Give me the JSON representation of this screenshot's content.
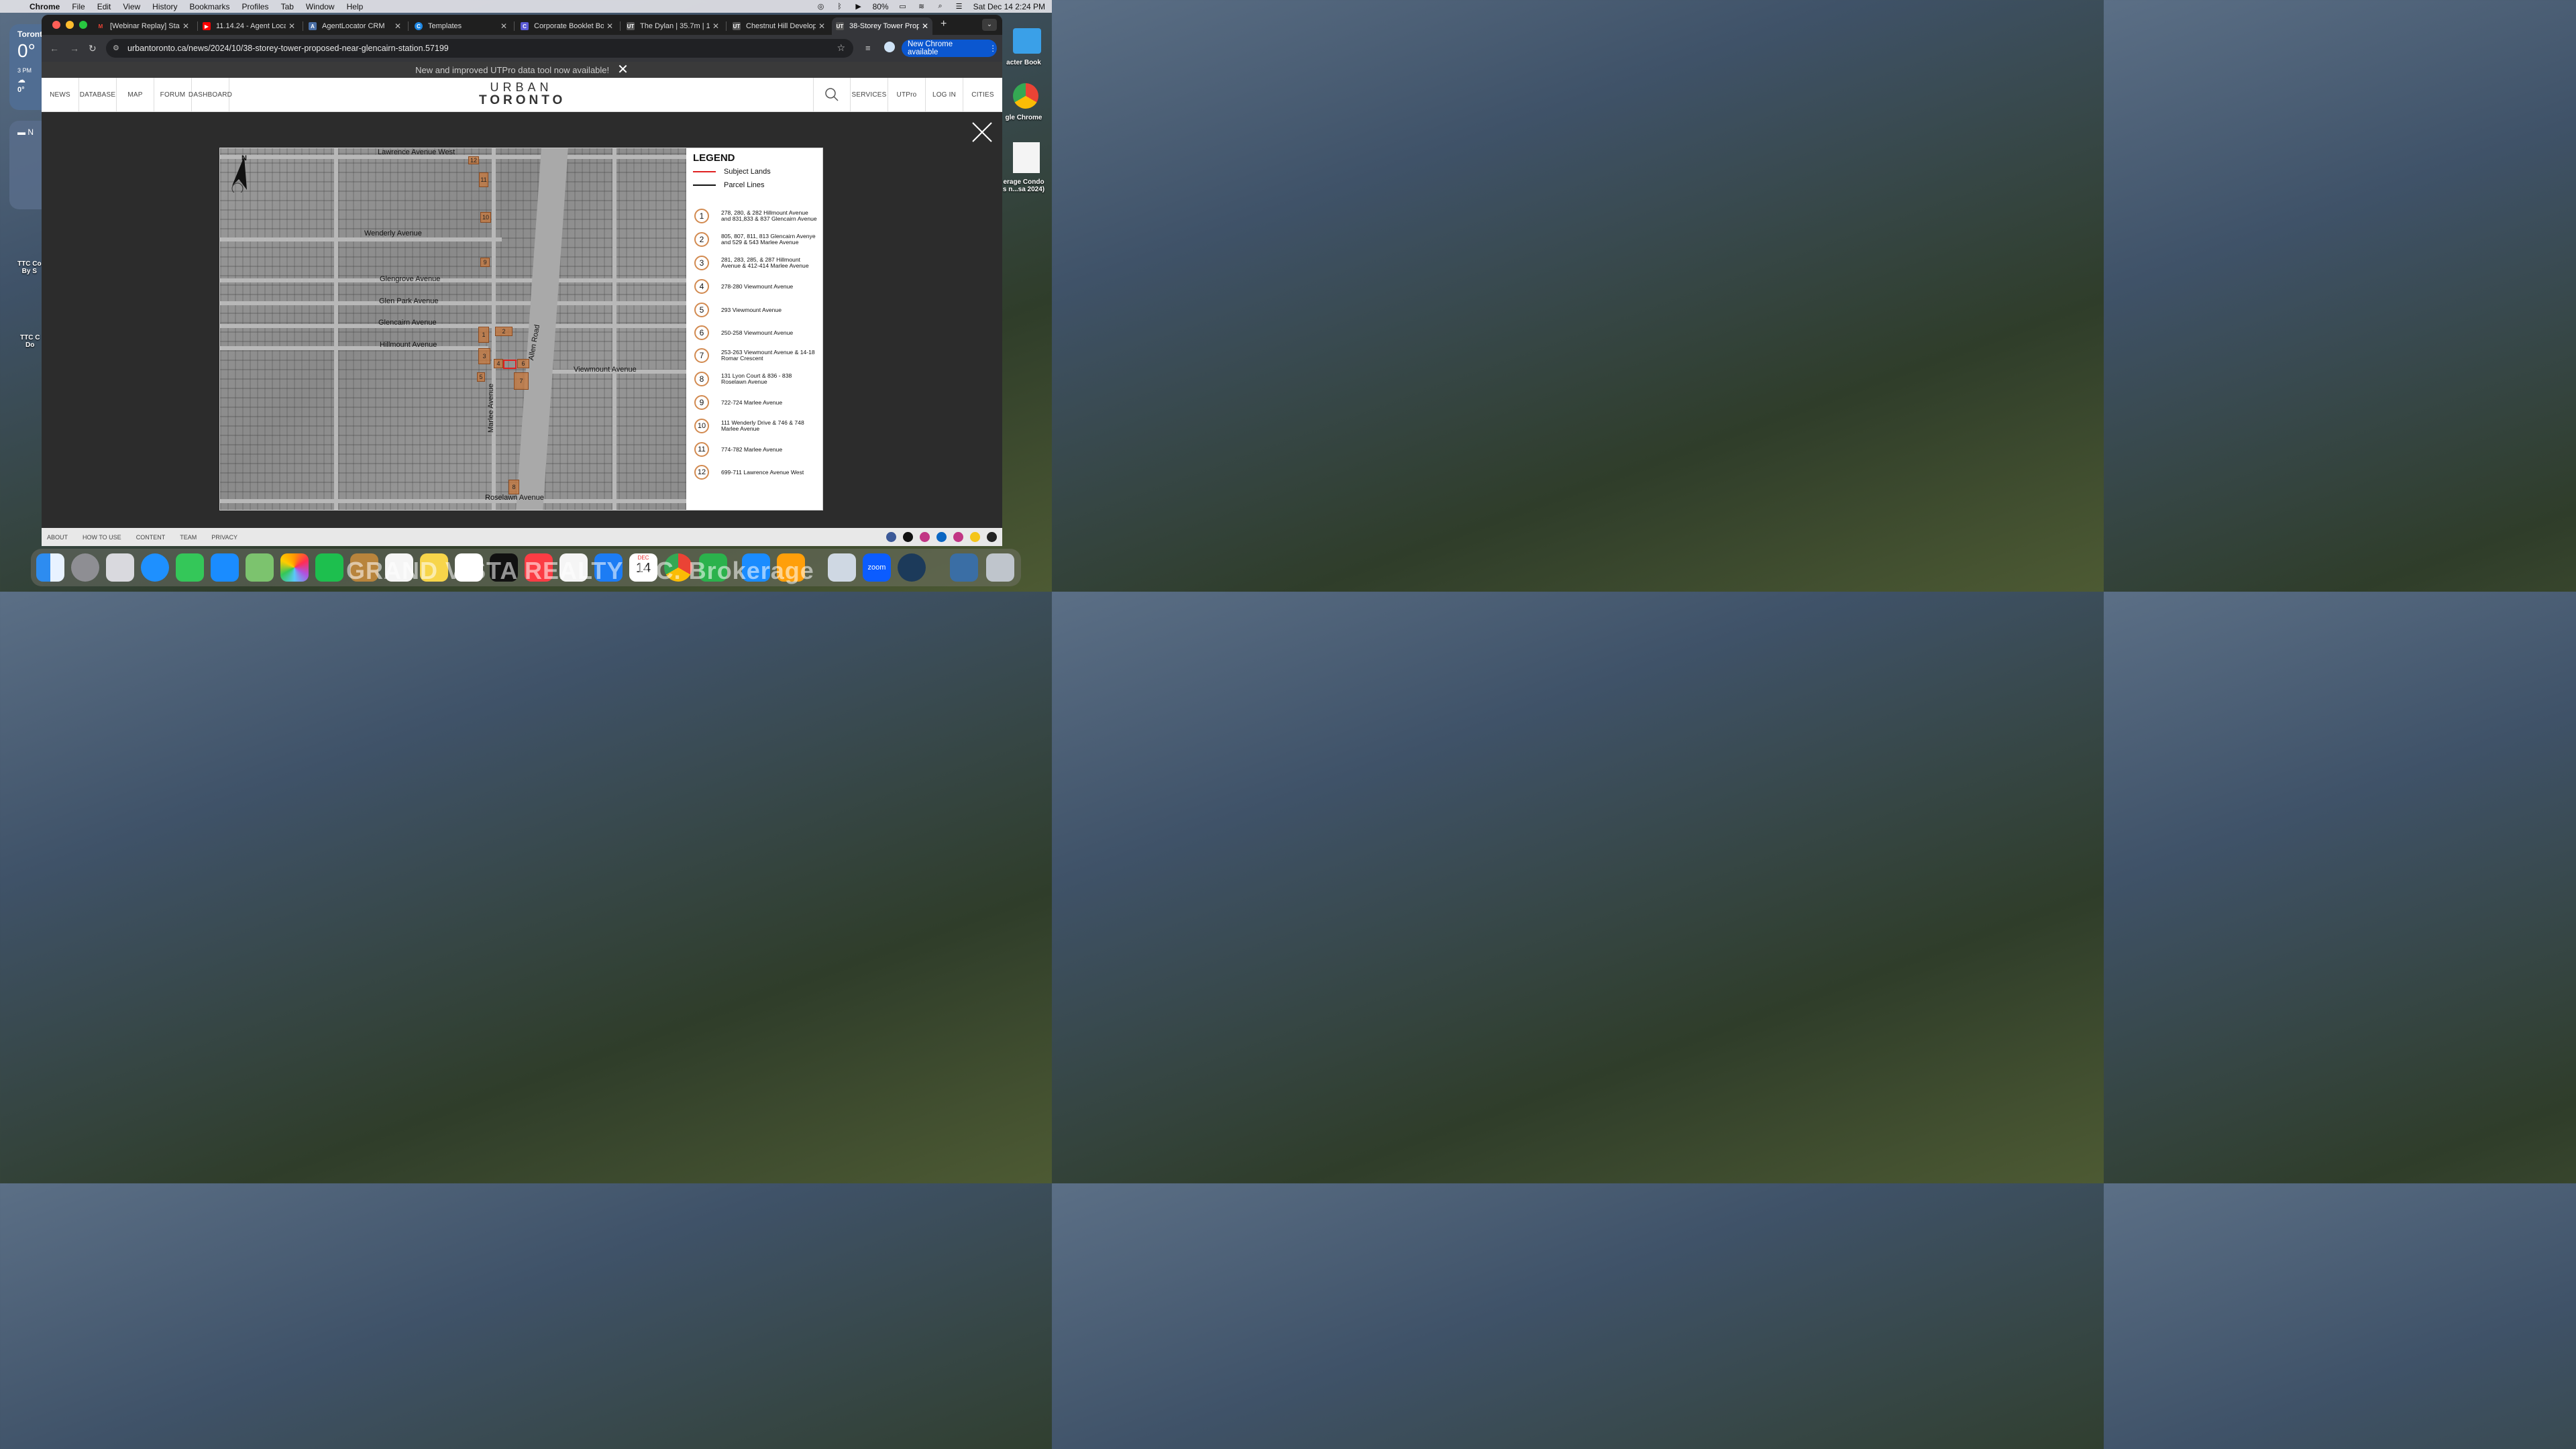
{
  "menubar": {
    "app": "Chrome",
    "items": [
      "File",
      "Edit",
      "View",
      "History",
      "Bookmarks",
      "Profiles",
      "Tab",
      "Window",
      "Help"
    ],
    "battery": "80%",
    "datetime": "Sat Dec 14  2:24 PM"
  },
  "weather": {
    "city": "Toront",
    "temp": "0°",
    "hour": "3 PM",
    "hour_temp": "0°"
  },
  "notes_widget": {
    "label": "N"
  },
  "desktop": {
    "left_items": [
      "TTC Co",
      "By S",
      "TTC C",
      "Do"
    ],
    "right_items": [
      "acter Book",
      "gle Chrome",
      "erage Condo",
      "s n...sa 2024)"
    ]
  },
  "tabs": [
    {
      "title": "[Webinar Replay] Sta",
      "color": "#ea4335",
      "glyph": "M"
    },
    {
      "title": "11.14.24 - Agent Loca",
      "color": "#ff0000",
      "glyph": "▶"
    },
    {
      "title": "AgentLocator CRM",
      "color": "#4a6fa5",
      "glyph": "A"
    },
    {
      "title": "Templates",
      "color": "#1e88e5",
      "glyph": "C"
    },
    {
      "title": "Corporate Booklet Bo",
      "color": "#5b5bd6",
      "glyph": "C"
    },
    {
      "title": "The Dylan | 35.7m | 1",
      "color": "#444",
      "glyph": "UT"
    },
    {
      "title": "Chestnut Hill Develop",
      "color": "#444",
      "glyph": "UT"
    },
    {
      "title": "38-Storey Tower Prop",
      "color": "#444",
      "glyph": "UT"
    }
  ],
  "omnibox": {
    "url": "urbantoronto.ca/news/2024/10/38-storey-tower-proposed-near-glencairn-station.57199"
  },
  "update_button": "New Chrome available",
  "banner": {
    "text": "New and improved UTPro data tool now available!"
  },
  "site_nav": {
    "left": [
      "NEWS",
      "DATABASE",
      "MAP",
      "FORUM",
      "DASHBOARD"
    ],
    "logo_top": "URBAN",
    "logo_bottom": "TORONTO",
    "right": [
      "SERVICES",
      "UTPro",
      "LOG IN",
      "CITIES"
    ]
  },
  "map": {
    "north": "N",
    "streets": [
      {
        "name": "Lawrence Avenue West"
      },
      {
        "name": "Wenderly Avenue"
      },
      {
        "name": "Glengrove Avenue"
      },
      {
        "name": "Glen Park Avenue"
      },
      {
        "name": "Glencairn Avenue"
      },
      {
        "name": "Hillmount Avenue"
      },
      {
        "name": "Viewmount Avenue"
      },
      {
        "name": "Allen Road"
      },
      {
        "name": "Marlee Avenue"
      },
      {
        "name": "Roselawn Avenue"
      }
    ],
    "legend": {
      "title": "LEGEND",
      "lines": [
        {
          "label": "Subject Lands",
          "color": "#e02020"
        },
        {
          "label": "Parcel Lines",
          "color": "#111111"
        }
      ],
      "items": [
        {
          "num": "1",
          "text": "278, 280, & 282 Hillmount Avenue and 831,833 & 837 Glencairn Avenue"
        },
        {
          "num": "2",
          "text": "805, 807, 811, 813 Glencairn Avenye and 529 & 543 Marlee Avenue"
        },
        {
          "num": "3",
          "text": "281, 283, 285, & 287 Hillmount Avenue & 412-414 Marlee Avenue"
        },
        {
          "num": "4",
          "text": "278-280 Viewmount Avenue"
        },
        {
          "num": "5",
          "text": "293 Viewmount Avenue"
        },
        {
          "num": "6",
          "text": "250-258 Viewmount Avenue"
        },
        {
          "num": "7",
          "text": "253-263 Viewmount Avenue & 14-18 Romar Crescent"
        },
        {
          "num": "8",
          "text": "131 Lyon Court & 836 - 838 Roselawn Avenue"
        },
        {
          "num": "9",
          "text": "722-724 Marlee Avenue"
        },
        {
          "num": "10",
          "text": "111 Wenderly Drive & 746 & 748 Marlee Avenue"
        },
        {
          "num": "11",
          "text": "774-782 Marlee Avenue"
        },
        {
          "num": "12",
          "text": "699-711 Lawrence Avenue West"
        }
      ]
    },
    "parcels": [
      "12",
      "11",
      "10",
      "9",
      "1",
      "2",
      "3",
      "4",
      "6",
      "5",
      "7",
      "8"
    ]
  },
  "footer": {
    "links": [
      "ABOUT",
      "HOW TO USE",
      "CONTENT",
      "TEAM",
      "PRIVACY"
    ]
  },
  "dock": {
    "overlay_text": "GRAND VISTA REALTY INC. Brokerage",
    "calendar_month": "DEC",
    "calendar_day": "14",
    "zoom": "zoom"
  }
}
